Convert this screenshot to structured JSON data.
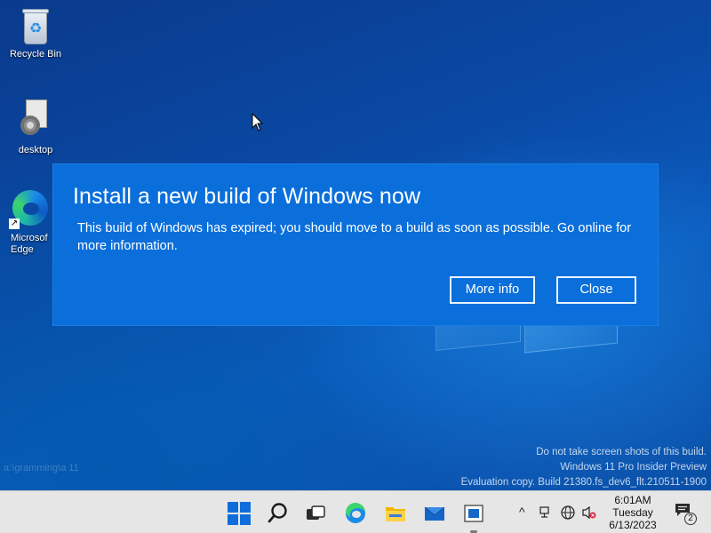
{
  "desktop": {
    "icons": [
      {
        "label": "Recycle Bin",
        "icon": "recycle-bin-icon"
      },
      {
        "label": "desktop",
        "icon": "file-gear-icon"
      },
      {
        "label": "Microsof\nEdge",
        "icon": "edge-icon"
      }
    ],
    "ghost_text": "a:\\gramming\\a 11"
  },
  "dialog": {
    "title": "Install a new build of Windows now",
    "body": "This build of Windows has expired; you should move to a build as soon as possible. Go online for more information.",
    "more_info_label": "More info",
    "close_label": "Close",
    "accent": "#0a6fdb"
  },
  "watermark": {
    "line1": "Do not take screen shots of this build.",
    "line2": "Windows 11 Pro Insider Preview",
    "line3": "Evaluation copy. Build 21380.fs_dev6_flt.210511-1900"
  },
  "taskbar": {
    "apps": [
      "start-icon",
      "search-icon",
      "task-view-icon",
      "edge-icon",
      "file-explorer-icon",
      "mail-icon",
      "app-icon"
    ],
    "tray": {
      "chevron": "^",
      "icons": [
        "network-icon",
        "globe-icon",
        "volume-muted-icon"
      ]
    },
    "clock": {
      "time": "6:01AM",
      "day": "Tuesday",
      "date": "6/13/2023"
    },
    "notification_count": "2"
  }
}
